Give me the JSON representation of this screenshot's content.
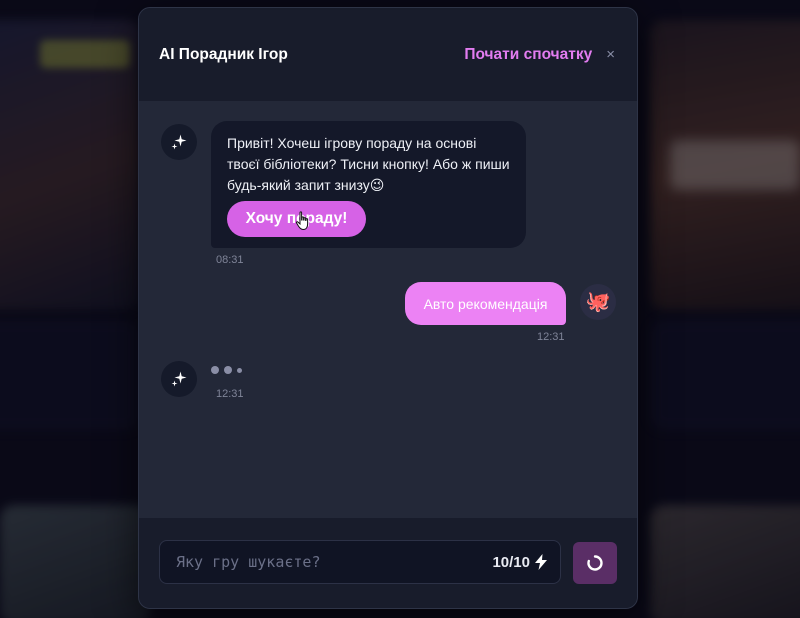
{
  "header": {
    "title": "AI Порадник Ігор",
    "restart_label": "Почати спочатку",
    "close_glyph": "×"
  },
  "messages": {
    "ai_greeting": {
      "text": "Привіт! Хочеш ігрову пораду на основі твоєї бібліотеки? Тисни кнопку! Або ж пиши будь-який запит знизу😉",
      "button_label": "Хочу пораду!",
      "time": "08:31"
    },
    "user_request": {
      "text": "Авто рекомендація",
      "time": "12:31",
      "avatar_emoji": "🐙"
    },
    "ai_typing": {
      "time": "12:31"
    }
  },
  "input": {
    "placeholder": "Яку гру шукаєте?",
    "value": "",
    "counter": "10/10"
  },
  "icons": {
    "ai_avatar": "sparkle-icon",
    "counter": "lightning-icon",
    "send": "loading-spinner-icon",
    "close": "close-icon"
  },
  "colors": {
    "accent": "#e27cf0",
    "button": "#d662e6",
    "user_bubble": "#ec82f4",
    "panel": "#232838",
    "header": "#181c2b"
  }
}
